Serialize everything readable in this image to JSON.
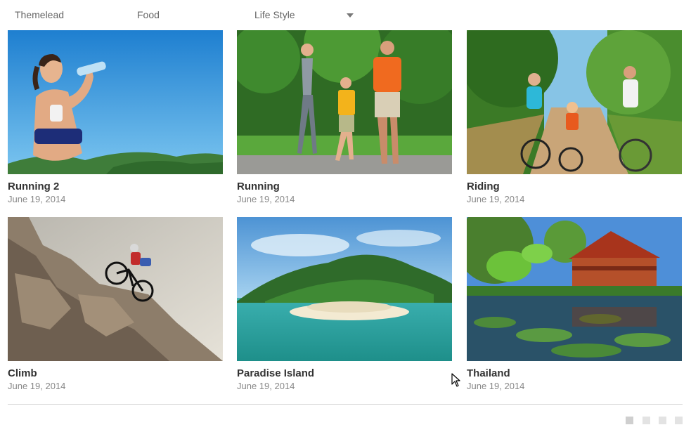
{
  "filters": {
    "items": [
      "Themelead",
      "Food",
      "Life Style"
    ],
    "dropdown_icon": "chevron-down-icon"
  },
  "posts": [
    {
      "title": "Running 2",
      "date": "June 19, 2014",
      "image": "woman-drinking-water-photo"
    },
    {
      "title": "Running",
      "date": "June 19, 2014",
      "image": "family-running-photo"
    },
    {
      "title": "Riding",
      "date": "June 19, 2014",
      "image": "family-bike-riding-photo"
    },
    {
      "title": "Climb",
      "date": "June 19, 2014",
      "image": "cyclist-on-rocks-photo"
    },
    {
      "title": "Paradise Island",
      "date": "June 19, 2014",
      "image": "tropical-island-photo"
    },
    {
      "title": "Thailand",
      "date": "June 19, 2014",
      "image": "thai-house-lily-pond-photo"
    }
  ],
  "pagination": {
    "pages": 4,
    "active": 1
  },
  "colors": {
    "title": "#333333",
    "date": "#888888",
    "filter": "#666666",
    "divider": "#d6d6d6",
    "dot": "#e3e3e3"
  }
}
